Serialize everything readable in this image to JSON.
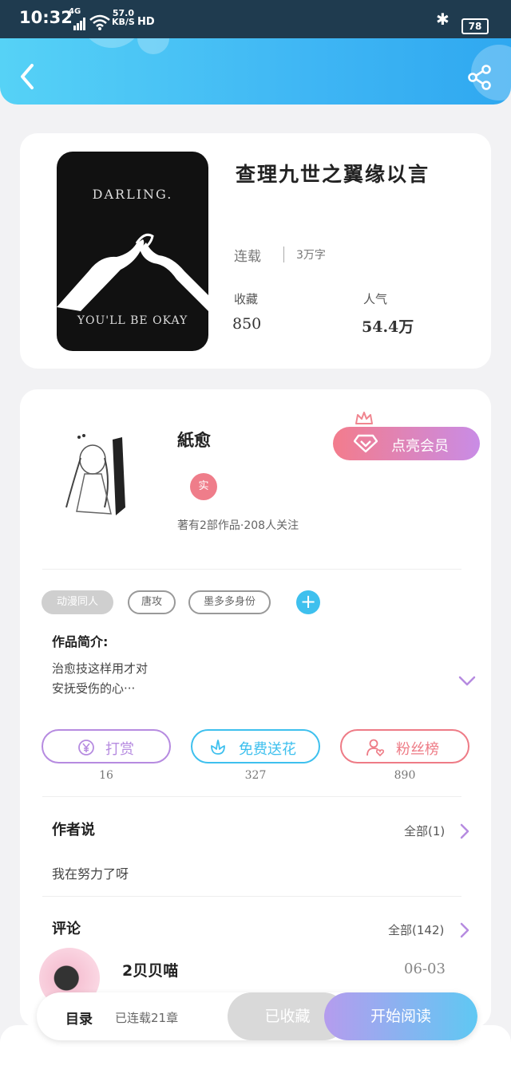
{
  "status_bar": {
    "time": "10:32",
    "network": "4G",
    "speed_value": "57.0",
    "speed_unit": "KB/S",
    "hd": "HD",
    "battery": "78"
  },
  "header": {
    "back_icon": "chevron-left-icon",
    "share_icon": "share-icon"
  },
  "book": {
    "cover_text_top": "DARLING.",
    "cover_text_bottom": "YOU'LL BE OKAY",
    "title": "查理九世之翼缘以言",
    "status": "连载",
    "word_count": "3万字",
    "favorites_label": "收藏",
    "favorites_value": "850",
    "popularity_label": "人气",
    "popularity_value": "54.4万"
  },
  "author": {
    "name": "紙愈",
    "verified_badge": "实",
    "works_info": "著有2部作品·208人关注",
    "vip_button": "点亮会员"
  },
  "tags": [
    "动漫同人",
    "唐攻",
    "墨多多身份"
  ],
  "intro": {
    "title": "作品简介:",
    "line1": "治愈技这样用才对",
    "line2": "安抚受伤的心···"
  },
  "actions": [
    {
      "label": "打赏",
      "count": "16",
      "color": "#b68be0"
    },
    {
      "label": "免费送花",
      "count": "327",
      "color": "#3ec0ee"
    },
    {
      "label": "粉丝榜",
      "count": "890",
      "color": "#ee7b86"
    }
  ],
  "author_says": {
    "title": "作者说",
    "more": "全部(1)",
    "content": "我在努力了呀"
  },
  "comments": {
    "title": "评论",
    "more": "全部(142)",
    "first_user": "2贝贝喵",
    "first_date": "06-03"
  },
  "bottom_bar": {
    "toc": "目录",
    "serial": "已连载21章",
    "favorited": "已收藏",
    "start_reading": "开始阅读"
  },
  "colors": {
    "header_start": "#56d2f6",
    "header_end": "#2fa8f0",
    "accent_purple": "#b68be0",
    "accent_blue": "#3ec0ee",
    "accent_pink": "#ee7b86"
  }
}
